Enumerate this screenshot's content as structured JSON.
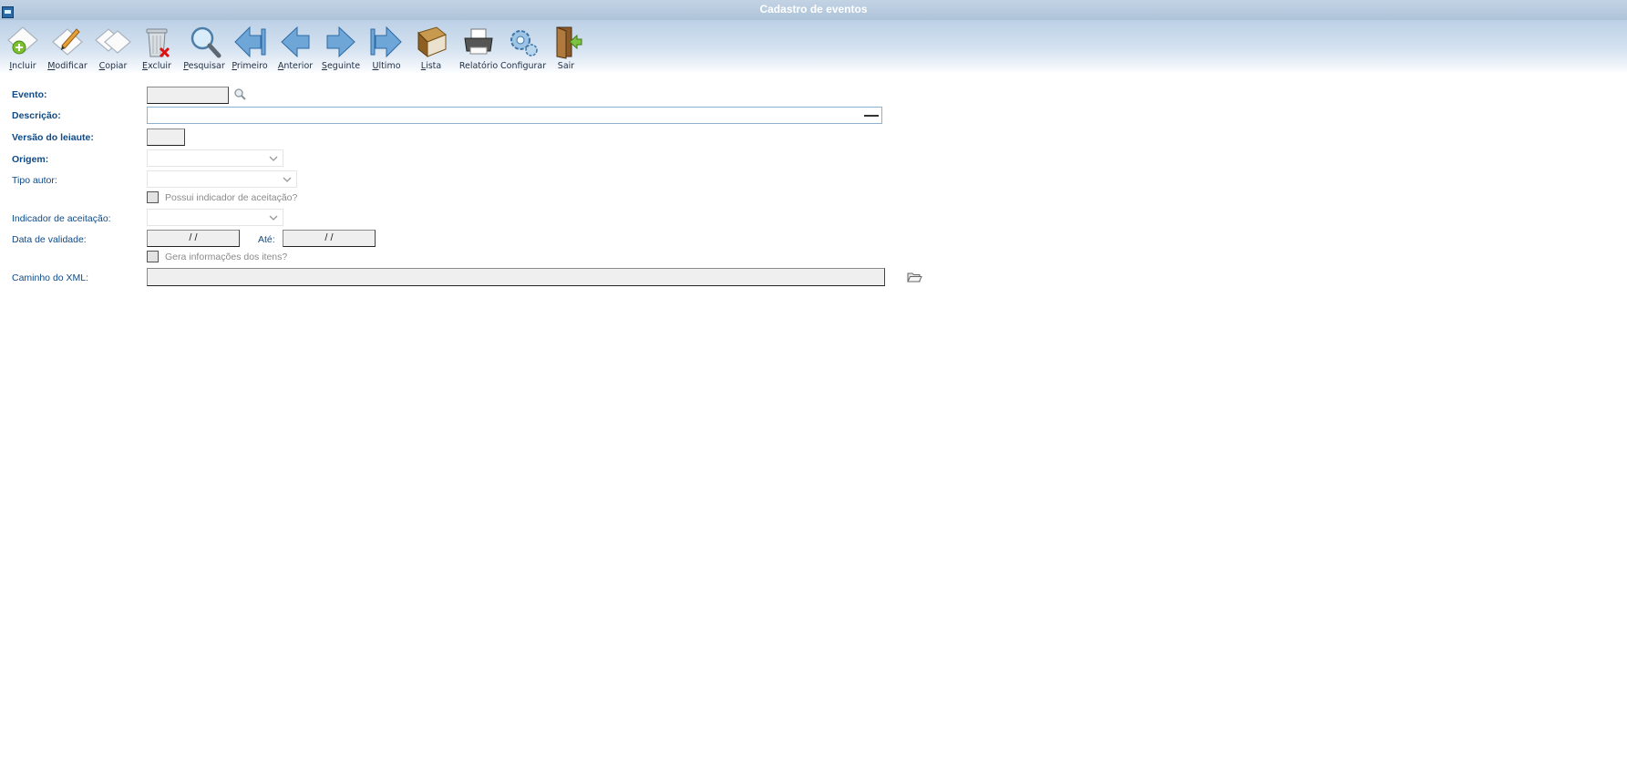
{
  "window": {
    "title": "Cadastro de eventos"
  },
  "toolbar": [
    {
      "key": "I",
      "rest": "ncluir",
      "icon": "add-icon"
    },
    {
      "key": "M",
      "rest": "odificar",
      "icon": "edit-icon"
    },
    {
      "key": "C",
      "rest": "opiar",
      "icon": "copy-icon"
    },
    {
      "key": "E",
      "rest": "xcluir",
      "icon": "trash-icon"
    },
    {
      "key": "P",
      "rest": "esquisar",
      "icon": "search-icon"
    },
    {
      "key": "P",
      "rest": "rimeiro",
      "icon": "first-icon"
    },
    {
      "key": "A",
      "rest": "nterior",
      "icon": "previous-icon"
    },
    {
      "key": "S",
      "rest": "eguinte",
      "icon": "next-icon"
    },
    {
      "key": "U",
      "rest": "ltimo",
      "icon": "last-icon"
    },
    {
      "key": "L",
      "rest": "ista",
      "icon": "book-icon"
    },
    {
      "key": "",
      "rest": "Relatório",
      "icon": "printer-icon"
    },
    {
      "key": "",
      "rest": "Configurar",
      "icon": "gear-icon"
    },
    {
      "key": "",
      "rest": "Sair",
      "icon": "exit-door-icon"
    }
  ],
  "form": {
    "evento_label": "Evento:",
    "descricao_label": "Descrição:",
    "versao_label": "Versão do leiaute:",
    "origem_label": "Origem:",
    "tipo_autor_label": "Tipo autor:",
    "possui_indicador_label": "Possui indicador de aceitação?",
    "indicador_label": "Indicador de aceitação:",
    "data_validade_label": "Data de validade:",
    "data_inicio_value": " /  /",
    "ate_label": "Até:",
    "data_fim_value": " /  /",
    "gera_info_label": "Gera informações dos itens?",
    "caminho_label": "Caminho do XML:"
  },
  "colors": {
    "label": "#0f4a86",
    "toolbar_top": "#bcd0e6",
    "title_bar": "#aec3d9"
  }
}
